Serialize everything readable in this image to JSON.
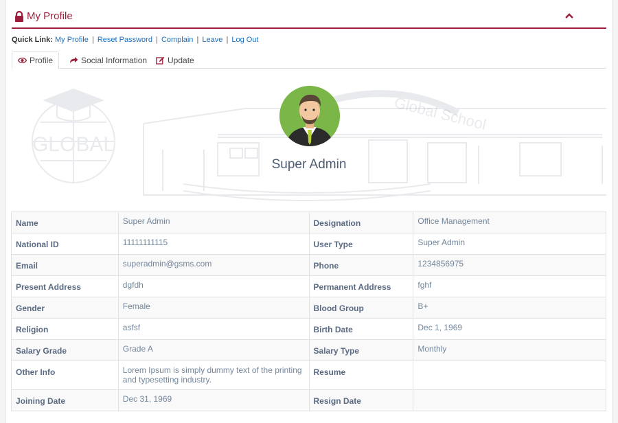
{
  "panel": {
    "title": "My Profile",
    "accent_color": "#9b1f3a"
  },
  "quick_links": {
    "label": "Quick Link:",
    "links": [
      "My Profile",
      "Reset Password",
      "Complain",
      "Leave",
      "Log Out"
    ],
    "separator": "|"
  },
  "tabs": [
    {
      "label": "Profile",
      "icon": "eye-icon",
      "active": true
    },
    {
      "label": "Social Information",
      "icon": "share-icon",
      "active": false
    },
    {
      "label": "Update",
      "icon": "edit-icon",
      "active": false
    }
  ],
  "hero": {
    "name": "Super Admin",
    "watermark_logo_text": "GLOBAL",
    "watermark_banner_text": "Global School"
  },
  "details": [
    [
      {
        "label": "Name",
        "value": "Super Admin"
      },
      {
        "label": "Designation",
        "value": "Office Management"
      }
    ],
    [
      {
        "label": "National ID",
        "value": "11111111115"
      },
      {
        "label": "User Type",
        "value": "Super Admin"
      }
    ],
    [
      {
        "label": "Email",
        "value": "superadmin@gsms.com"
      },
      {
        "label": "Phone",
        "value": "1234856975"
      }
    ],
    [
      {
        "label": "Present Address",
        "value": "dgfdh"
      },
      {
        "label": "Permanent Address",
        "value": "fghf"
      }
    ],
    [
      {
        "label": "Gender",
        "value": "Female"
      },
      {
        "label": "Blood Group",
        "value": "B+"
      }
    ],
    [
      {
        "label": "Religion",
        "value": "asfsf"
      },
      {
        "label": "Birth Date",
        "value": "Dec 1, 1969"
      }
    ],
    [
      {
        "label": "Salary Grade",
        "value": "Grade A"
      },
      {
        "label": "Salary Type",
        "value": "Monthly"
      }
    ],
    [
      {
        "label": "Other Info",
        "value": "Lorem Ipsum is simply dummy text of the printing and typesetting industry."
      },
      {
        "label": "Resume",
        "value": ""
      }
    ],
    [
      {
        "label": "Joining Date",
        "value": "Dec 31, 1969"
      },
      {
        "label": "Resign Date",
        "value": ""
      }
    ]
  ]
}
